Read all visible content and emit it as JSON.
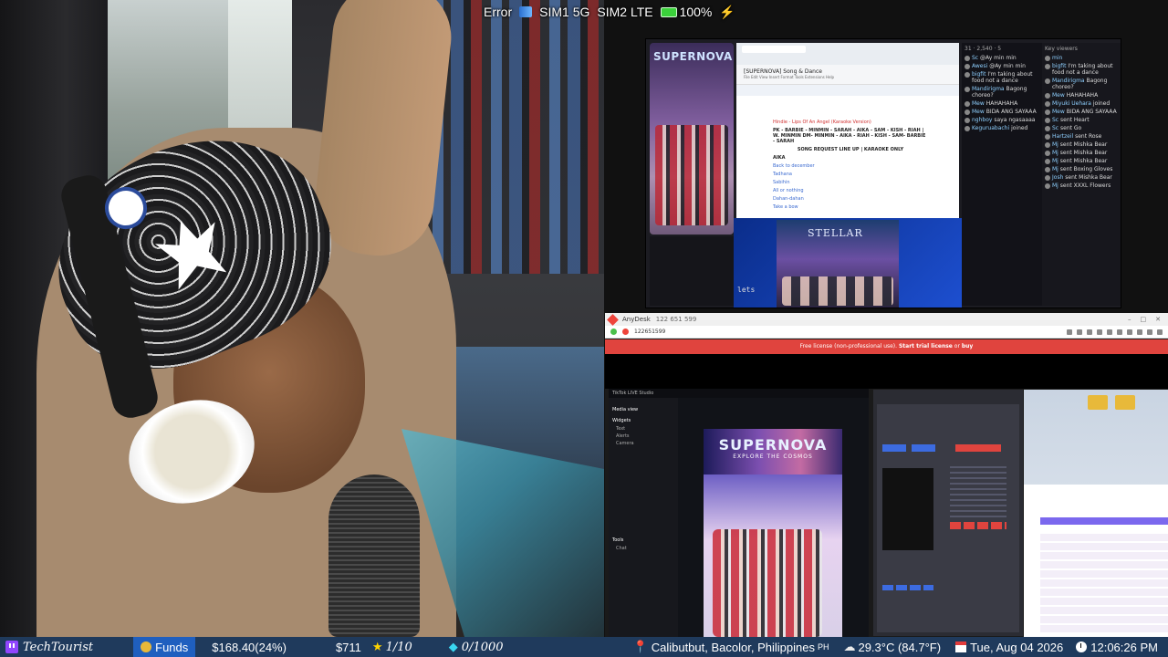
{
  "top_status": {
    "error": "Error",
    "sim1": "SIM1 5G",
    "sim2": "SIM2 LTE",
    "battery": "100%",
    "charging_icon": "bolt-icon"
  },
  "share_top": {
    "phone_brand": "SUPERNOVA",
    "doc_title": "[SUPERNOVA] Song & Dance",
    "doc_menu": "File  Edit  View  Insert  Format  Tools  Extensions  Help",
    "doc_line1": "Hindie - Lips Of An Angel (Karaoke Version)",
    "doc_line2": "PK - BARBIE - MINMIN - SARAH - AIKA - SAM - KISH - RIAH | W. MINMIN DM- MINMIN - AIKA - RIAH - KISH - SAM- BARBIE - SARAH",
    "doc_line3": "SONG REQUEST LINE UP | KARAOKE ONLY",
    "doc_line4": "AIKA",
    "doc_links": [
      "Back to december",
      "Tadhana",
      "Sabihin",
      "All or nothing",
      "Dahan-dahan",
      "Take a bow"
    ],
    "stellar": "STELLAR",
    "term": "lets",
    "chat_stats": [
      "31",
      "2,540",
      "5"
    ],
    "chat1": [
      {
        "name": "Sc",
        "text": "@Ay min min"
      },
      {
        "name": "Awesi",
        "text": "@Ay min min"
      },
      {
        "name": "bigfit",
        "text": "I'm taking about food not a dance"
      },
      {
        "name": "Mandirigma",
        "text": "Bagong choreo?"
      },
      {
        "name": "Mew",
        "text": "HAHAHAHA"
      },
      {
        "name": "Mew",
        "text": "BIDA ANG SAYAAA"
      },
      {
        "name": "nghboy",
        "text": "saya ngasaaaa"
      },
      {
        "name": "Keguruabachi",
        "text": "joined"
      }
    ],
    "chat2_header": "Key viewers",
    "chat2": [
      {
        "name": "min",
        "text": ""
      },
      {
        "name": "bigfit",
        "text": "I'm taking about food not a dance"
      },
      {
        "name": "Mandirigma",
        "text": "Bagong choreo?"
      },
      {
        "name": "Mew",
        "text": "HAHAHAHA"
      },
      {
        "name": "Miyuki Uehara",
        "text": "joined"
      },
      {
        "name": "Mew",
        "text": "BIDA ANG SAYAAA"
      },
      {
        "name": "Sc",
        "text": "sent Heart"
      },
      {
        "name": "Sc",
        "text": "sent Go"
      },
      {
        "name": "Hartzeil",
        "text": "sent Rose"
      },
      {
        "name": "Mj",
        "text": "sent Mishka Bear"
      },
      {
        "name": "Mj",
        "text": "sent Mishka Bear"
      },
      {
        "name": "Mj",
        "text": "sent Mishka Bear"
      },
      {
        "name": "Mj",
        "text": "sent Boxing Gloves"
      },
      {
        "name": "Josh",
        "text": "sent Mishka Bear"
      },
      {
        "name": "Mj",
        "text": "sent XXXL Flowers"
      }
    ]
  },
  "anydesk": {
    "app_name": "AnyDesk",
    "session_id": "122 651 599",
    "tab_id": "122651599",
    "banner_prefix": "Free license (non-professional use).",
    "banner_link1": "Start trial license",
    "banner_mid": "or",
    "banner_link2": "buy",
    "tiktok_title": "TikTok LIVE Studio",
    "tiktok_scene": "Media view",
    "tiktok_sidebar": [
      "Widgets",
      "Text",
      "Alerts",
      "Camera",
      "Tools",
      "Chat"
    ],
    "tiktok_banner_title": "SUPERNOVA",
    "tiktok_banner_sub": "EXPLORE THE COSMOS"
  },
  "ticker": {
    "channel": "TechTourist",
    "funds_label": "Funds",
    "funds_value": "$168.40(24%)",
    "amount2": "$711",
    "stars": "1/10",
    "diamonds": "0/1000",
    "location": "Calibutbut, Bacolor, Philippines",
    "country_code": "PH",
    "weather": "29.3°C (84.7°F)",
    "date": "Tue, Aug 04 2026",
    "time": "12:06:26 PM"
  }
}
